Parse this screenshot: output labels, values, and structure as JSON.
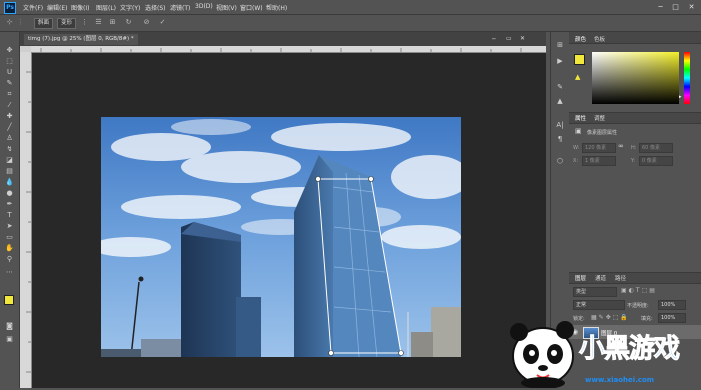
{
  "menu": [
    "文件(F)",
    "编辑(E)",
    "图像(I)",
    "图层(L)",
    "文字(Y)",
    "选择(S)",
    "滤镜(T)",
    "3D(D)",
    "视图(V)",
    "窗口(W)",
    "帮助(H)"
  ],
  "app_logo": "Ps",
  "window_controls": {
    "minimize": "─",
    "maximize": "□",
    "close": "✕"
  },
  "options": {
    "mode_btn1": "斜面",
    "mode_btn2": "变形"
  },
  "document": {
    "tab_title": "timg (7).jpg @ 25% (图层 0, RGB/8#) *"
  },
  "panels": {
    "color_tab": "颜色",
    "swatches_tab": "色板",
    "properties_tab": "属性",
    "adjust_tab": "调整",
    "pixel_layer_props": "像素图层属性",
    "w_label": "W:",
    "w_value": "120 像素",
    "h_label": "H:",
    "h_value": "60 像素",
    "x_label": "X:",
    "x_value": "1 像素",
    "y_label": "Y:",
    "y_value": "0 像素",
    "layers_tab": "图层",
    "channels_tab": "通道",
    "paths_tab": "路径",
    "kind_label": "类型",
    "blend_mode": "正常",
    "opacity_label": "不透明度:",
    "opacity_value": "100%",
    "lock_label": "锁定:",
    "fill_label": "填充:",
    "fill_value": "100%",
    "layer_name": "图层 0"
  },
  "watermark": {
    "logo_text": "小黑游戏",
    "url": "www.xiaohei.com"
  },
  "colors": {
    "accent": "#31a8ff",
    "foreground": "#f2e83c",
    "background": "#ffffff",
    "panel": "#535353",
    "canvas_bg": "#282828"
  }
}
